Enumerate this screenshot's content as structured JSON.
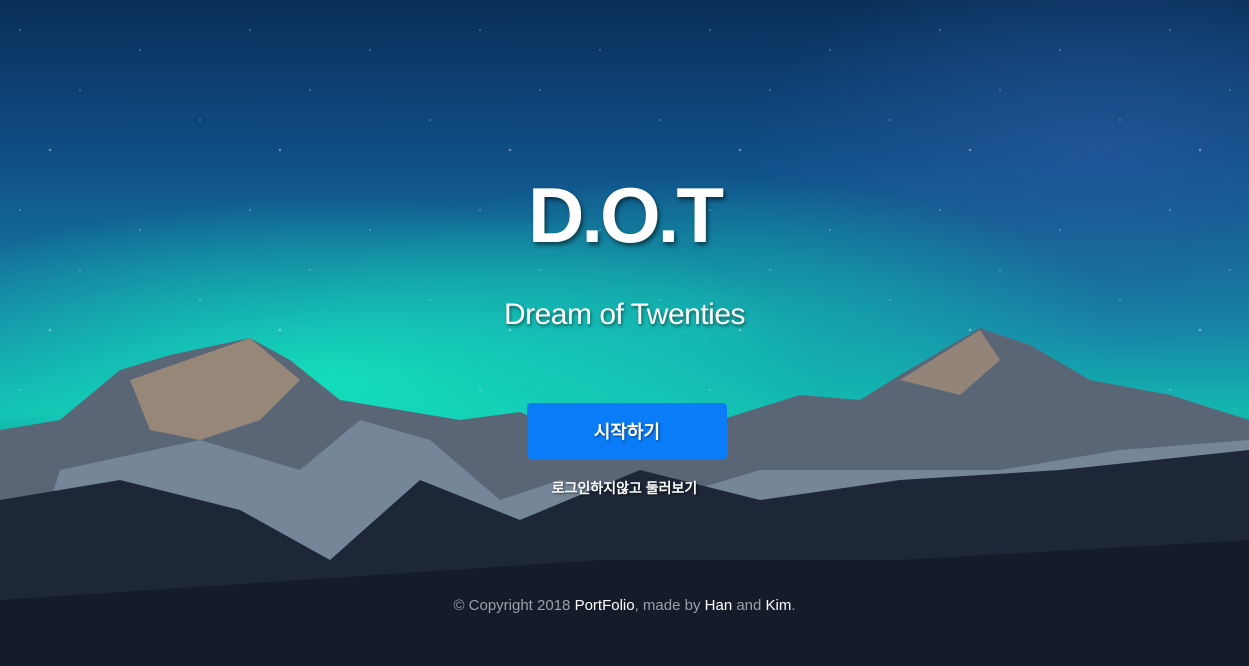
{
  "hero": {
    "title": "D.O.T",
    "tagline": "Dream of Twenties"
  },
  "actions": {
    "start_label": "시작하기",
    "guest_label": "로그인하지않고 둘러보기"
  },
  "footer": {
    "prefix": "© Copyright 2018",
    "portfolio": "PortFolio",
    "made_by": ", made by",
    "han": "Han",
    "and": "and",
    "kim": "Kim",
    "end": "."
  },
  "colors": {
    "primary_button": "#0a7cf7"
  }
}
